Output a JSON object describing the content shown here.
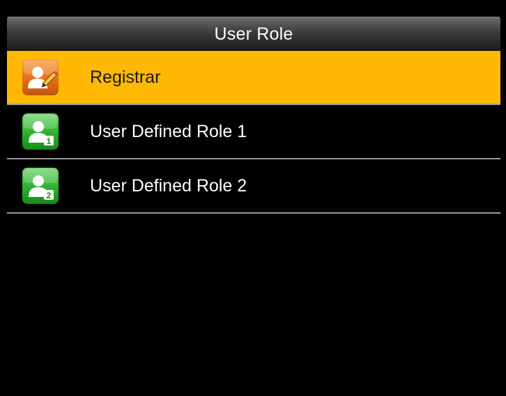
{
  "header": {
    "title": "User Role"
  },
  "menu": {
    "items": [
      {
        "label": "Registrar",
        "icon": "user-edit-icon",
        "selected": true,
        "accent": "#ffb803"
      },
      {
        "label": "User Defined Role 1",
        "icon": "user-role-1-icon",
        "selected": false
      },
      {
        "label": "User Defined Role 2",
        "icon": "user-role-2-icon",
        "selected": false
      }
    ]
  },
  "icon_badges": {
    "role1": "1",
    "role2": "2"
  },
  "colors": {
    "background": "#000000",
    "selection": "#ffb803",
    "divider": "#9a9a9a",
    "icon_orange": "#e8731d",
    "icon_green": "#2fb52f"
  }
}
